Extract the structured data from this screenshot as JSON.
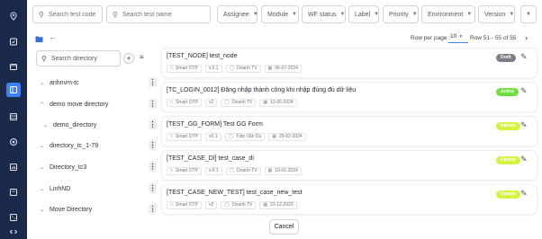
{
  "rail": {
    "icons": [
      "location-icon",
      "calendar-check-icon",
      "folder-icon",
      "test-cases-icon",
      "table-icon",
      "target-icon",
      "chart-icon",
      "window-icon",
      "settings-icon",
      "code-icon"
    ],
    "active_index": 3,
    "accent_color": "#3f7ff7",
    "background_color": "#1b2a4a"
  },
  "filters": {
    "search_code_placeholder": "Search test code",
    "search_name_placeholder": "Search test name",
    "assignee": "Assignee",
    "module": "Module",
    "wf_status": "WF status",
    "label": "Label",
    "priority": "Priority",
    "environment": "Environment",
    "version": "Version"
  },
  "pagination": {
    "rows_per_page_label": "Row per page :",
    "rows_per_page_value": "10",
    "range_text": "Row 51 - 55 of 55"
  },
  "directory": {
    "search_placeholder": "Search directory",
    "items": [
      {
        "label": "anhnvm-tc"
      },
      {
        "label": "demo move directory"
      },
      {
        "label": "demo_directory"
      },
      {
        "label": "directory_tc_1-79"
      },
      {
        "label": "Directory_tc3"
      },
      {
        "label": "LinhND"
      },
      {
        "label": "Move Directory"
      }
    ]
  },
  "tests": [
    {
      "title": "[TEST_NODE] test_node",
      "tool": "Smart OTP",
      "version": "v.0.1",
      "owner": "Doanh TV",
      "date": "06-07-2024",
      "status": "Draft"
    },
    {
      "title": "[TC_LOGIN_0012] Đăng nhập thành công khi nhập đúng đủ dữ liệu",
      "tool": "Smart OTP",
      "version": "v2",
      "owner": "Doanh TV",
      "date": "12-06-2024",
      "status": "Active"
    },
    {
      "title": "[TEST_GG_FORM] Test GG Form",
      "tool": "Smart OTP",
      "version": "v0.1",
      "owner": "Trần Văn Du",
      "date": "29-02-2024",
      "status": "Update"
    },
    {
      "title": "[TEST_CASE_DI] test_case_di",
      "tool": "Smart OTP",
      "version": "v.0.1",
      "owner": "Doanh TV",
      "date": "10-01-2024",
      "status": "Update"
    },
    {
      "title": "[TEST_CASE_NEW_TEST] test_case_new_test",
      "tool": "Smart OTP",
      "version": "v2",
      "owner": "Doanh TV",
      "date": "22-12-2023",
      "status": "Update"
    }
  ],
  "status_colors": {
    "Draft": "#7a7f87",
    "Active": "#6ee03c",
    "Update": "#d7f23a"
  },
  "cancel_label": "Cancel"
}
